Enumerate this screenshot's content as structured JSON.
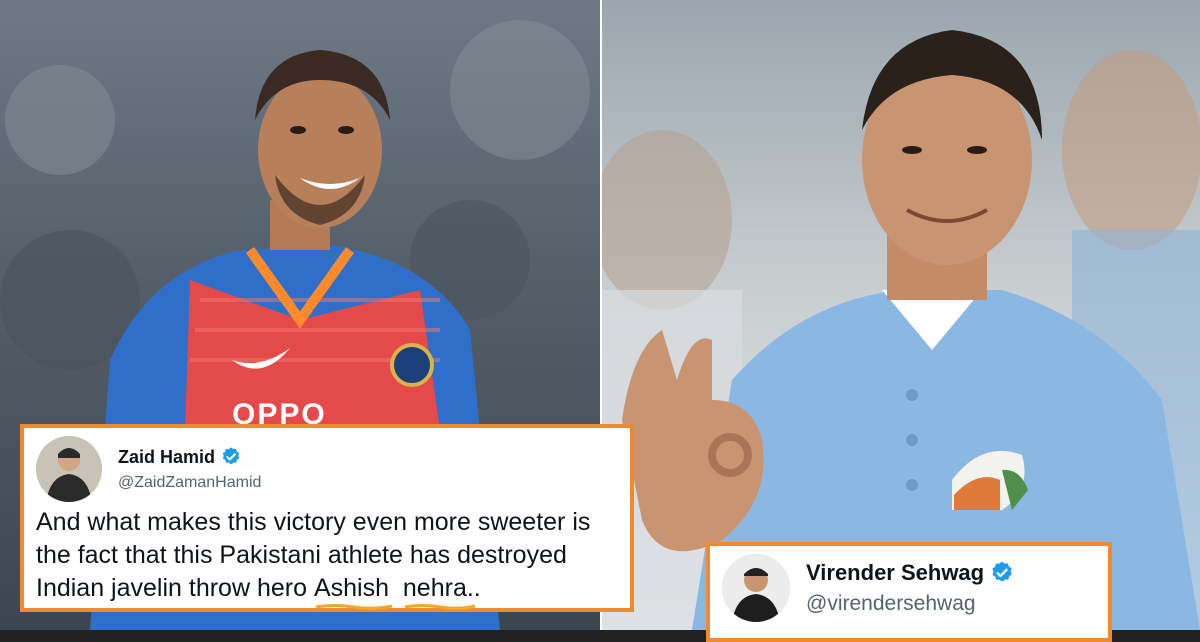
{
  "colors": {
    "frame_accent": "#f08a2e",
    "verified_blue": "#1d9bf0",
    "underline_accent": "#f5a623"
  },
  "left_tweet": {
    "display_name": "Zaid Hamid",
    "handle": "@ZaidZamanHamid",
    "verified_icon": "verified-badge",
    "text_main": "And what makes this victory even more sweeter is the fact that this Pakistani athlete has destroyed Indian javelin throw hero ",
    "highlight_1": "Ashish",
    "highlight_2": "nehra",
    "trailing": ".."
  },
  "right_tweet": {
    "display_name": "Virender Sehwag",
    "handle": "@virendersehwag",
    "verified_icon": "verified-badge"
  },
  "left_photo": {
    "jersey_logo": "OPPO"
  }
}
